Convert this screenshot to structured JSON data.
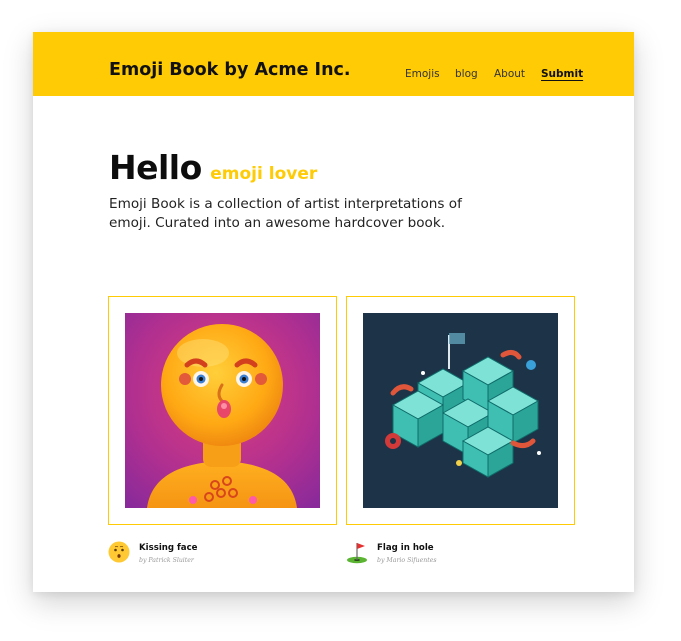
{
  "site": {
    "title": "Emoji Book by Acme Inc."
  },
  "nav": [
    {
      "label": "Emojis",
      "active": false
    },
    {
      "label": "blog",
      "active": false
    },
    {
      "label": "About",
      "active": false
    },
    {
      "label": "Submit",
      "active": true
    }
  ],
  "hero": {
    "heading": "Hello",
    "subheading": "emoji lover",
    "description": "Emoji Book is a collection of artist interpretations of emoji. Curated into an awesome hardcover book."
  },
  "gallery": [
    {
      "title": "Kissing face",
      "author": "by Patrick Sluiter",
      "icon": "kissing-face-icon"
    },
    {
      "title": "Flag in hole",
      "author": "by Mario Sifuentes",
      "icon": "flag-in-hole-icon"
    }
  ],
  "colors": {
    "accent": "#ffcb05",
    "text": "#111111",
    "tile_dark": "#1c3348",
    "tile_magenta": "#b0308f"
  }
}
